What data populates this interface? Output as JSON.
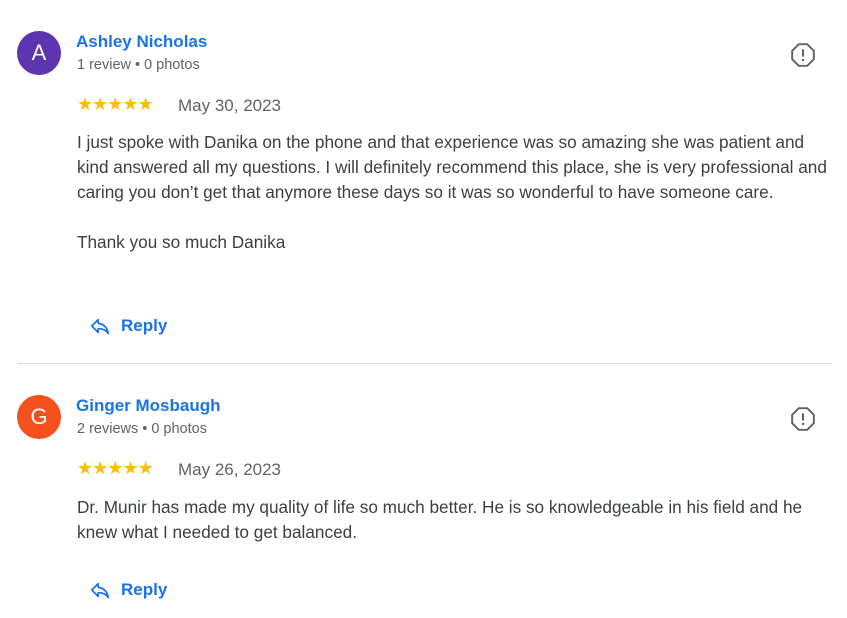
{
  "colors": {
    "link": "#1a73e8",
    "star": "#fbbc04",
    "meta": "#5f6368",
    "body_text": "#3c4043",
    "divider": "#dadce0"
  },
  "reviews": [
    {
      "avatar_letter": "A",
      "avatar_color": "#5e35b1",
      "author": "Ashley Nicholas",
      "review_count": "1 review",
      "photo_count": "0 photos",
      "rating": 5,
      "stars": "★★★★★",
      "date": "May 30, 2023",
      "paragraphs": [
        "I just spoke with Danika on the phone and that experience was so amazing she was patient and kind answered all my questions. I will definitely recommend this place, she is very professional and caring you don’t get that anymore these days so it was so wonderful to have someone care.",
        "Thank you so much Danika"
      ],
      "reply_label": "Reply"
    },
    {
      "avatar_letter": "G",
      "avatar_color": "#f4511e",
      "author": "Ginger Mosbaugh",
      "review_count": "2 reviews",
      "photo_count": "0 photos",
      "rating": 5,
      "stars": "★★★★★",
      "date": "May 26, 2023",
      "paragraphs": [
        "Dr. Munir has made my quality of life so much better. He is so knowledgeable in his field and he knew what I needed to get balanced."
      ],
      "reply_label": "Reply"
    }
  ],
  "icons": {
    "report": "report-flag-icon",
    "reply": "reply-arrow-icon"
  }
}
